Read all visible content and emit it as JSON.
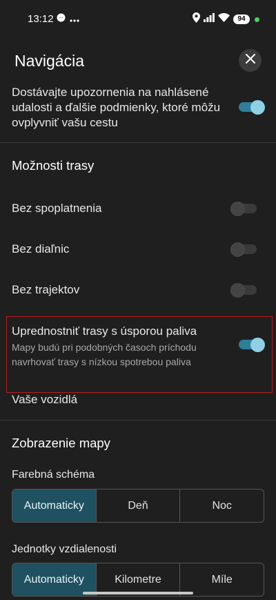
{
  "status_bar": {
    "time": "13:12",
    "battery": "94"
  },
  "header": {
    "title": "Navigácia"
  },
  "alerts": {
    "label": "Dostávajte upozornenia na nahlásené udalosti a ďalšie podmienky, ktoré môžu ovplyvniť vašu cestu",
    "enabled": true
  },
  "route_options": {
    "title": "Možnosti trasy",
    "items": [
      {
        "label": "Bez spoplatnenia",
        "enabled": false
      },
      {
        "label": "Bez diaľnic",
        "enabled": false
      },
      {
        "label": "Bez trajektov",
        "enabled": false
      }
    ],
    "fuel": {
      "label": "Uprednostniť trasy s úsporou paliva",
      "description": "Mapy budú pri podobných časoch príchodu navrhovať trasy s nízkou spotrebou paliva",
      "enabled": true
    },
    "vehicles_label": "Vaše vozidlá"
  },
  "map_display": {
    "title": "Zobrazenie mapy",
    "color_scheme": {
      "label": "Farebná schéma",
      "options": [
        "Automaticky",
        "Deň",
        "Noc"
      ],
      "selected": "Automaticky"
    },
    "distance_units": {
      "label": "Jednotky vzdialenosti",
      "options": [
        "Automaticky",
        "Kilometre",
        "Míle"
      ],
      "selected": "Automaticky"
    }
  },
  "colors": {
    "toggle_on_track": "#2e7f97",
    "toggle_on_thumb": "#8fd0e4",
    "selected_segment": "#1f5160",
    "highlight_border": "#b81d1d",
    "background": "#1f1f1f"
  }
}
